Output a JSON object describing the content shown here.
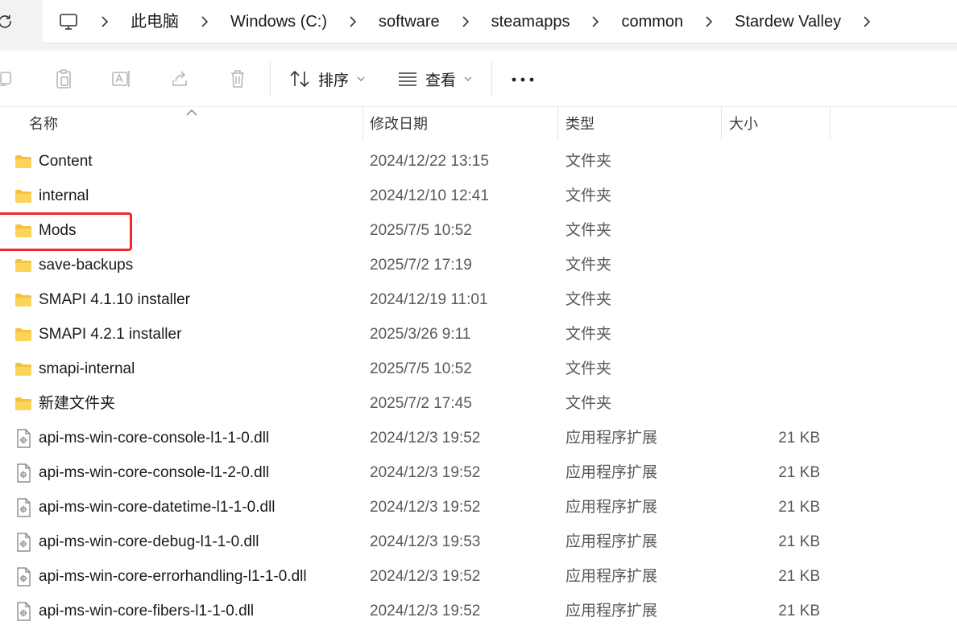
{
  "address": {
    "crumbs": [
      "此电脑",
      "Windows (C:)",
      "software",
      "steamapps",
      "common",
      "Stardew Valley"
    ]
  },
  "toolbar": {
    "sort_label": "排序",
    "view_label": "查看"
  },
  "columns": {
    "name": "名称",
    "date": "修改日期",
    "type": "类型",
    "size": "大小"
  },
  "files": [
    {
      "name": "Content",
      "date": "2024/12/22 13:15",
      "type": "文件夹",
      "size": "",
      "kind": "folder"
    },
    {
      "name": "internal",
      "date": "2024/12/10 12:41",
      "type": "文件夹",
      "size": "",
      "kind": "folder"
    },
    {
      "name": "Mods",
      "date": "2025/7/5 10:52",
      "type": "文件夹",
      "size": "",
      "kind": "folder"
    },
    {
      "name": "save-backups",
      "date": "2025/7/2 17:19",
      "type": "文件夹",
      "size": "",
      "kind": "folder"
    },
    {
      "name": "SMAPI 4.1.10 installer",
      "date": "2024/12/19 11:01",
      "type": "文件夹",
      "size": "",
      "kind": "folder"
    },
    {
      "name": "SMAPI 4.2.1 installer",
      "date": "2025/3/26 9:11",
      "type": "文件夹",
      "size": "",
      "kind": "folder"
    },
    {
      "name": "smapi-internal",
      "date": "2025/7/5 10:52",
      "type": "文件夹",
      "size": "",
      "kind": "folder"
    },
    {
      "name": "新建文件夹",
      "date": "2025/7/2 17:45",
      "type": "文件夹",
      "size": "",
      "kind": "folder"
    },
    {
      "name": "api-ms-win-core-console-l1-1-0.dll",
      "date": "2024/12/3 19:52",
      "type": "应用程序扩展",
      "size": "21 KB",
      "kind": "file"
    },
    {
      "name": "api-ms-win-core-console-l1-2-0.dll",
      "date": "2024/12/3 19:52",
      "type": "应用程序扩展",
      "size": "21 KB",
      "kind": "file"
    },
    {
      "name": "api-ms-win-core-datetime-l1-1-0.dll",
      "date": "2024/12/3 19:52",
      "type": "应用程序扩展",
      "size": "21 KB",
      "kind": "file"
    },
    {
      "name": "api-ms-win-core-debug-l1-1-0.dll",
      "date": "2024/12/3 19:53",
      "type": "应用程序扩展",
      "size": "21 KB",
      "kind": "file"
    },
    {
      "name": "api-ms-win-core-errorhandling-l1-1-0.dll",
      "date": "2024/12/3 19:52",
      "type": "应用程序扩展",
      "size": "21 KB",
      "kind": "file"
    },
    {
      "name": "api-ms-win-core-fibers-l1-1-0.dll",
      "date": "2024/12/3 19:52",
      "type": "应用程序扩展",
      "size": "21 KB",
      "kind": "file"
    }
  ],
  "highlight_color": "#f0262b",
  "folder_color": "#f4c240"
}
